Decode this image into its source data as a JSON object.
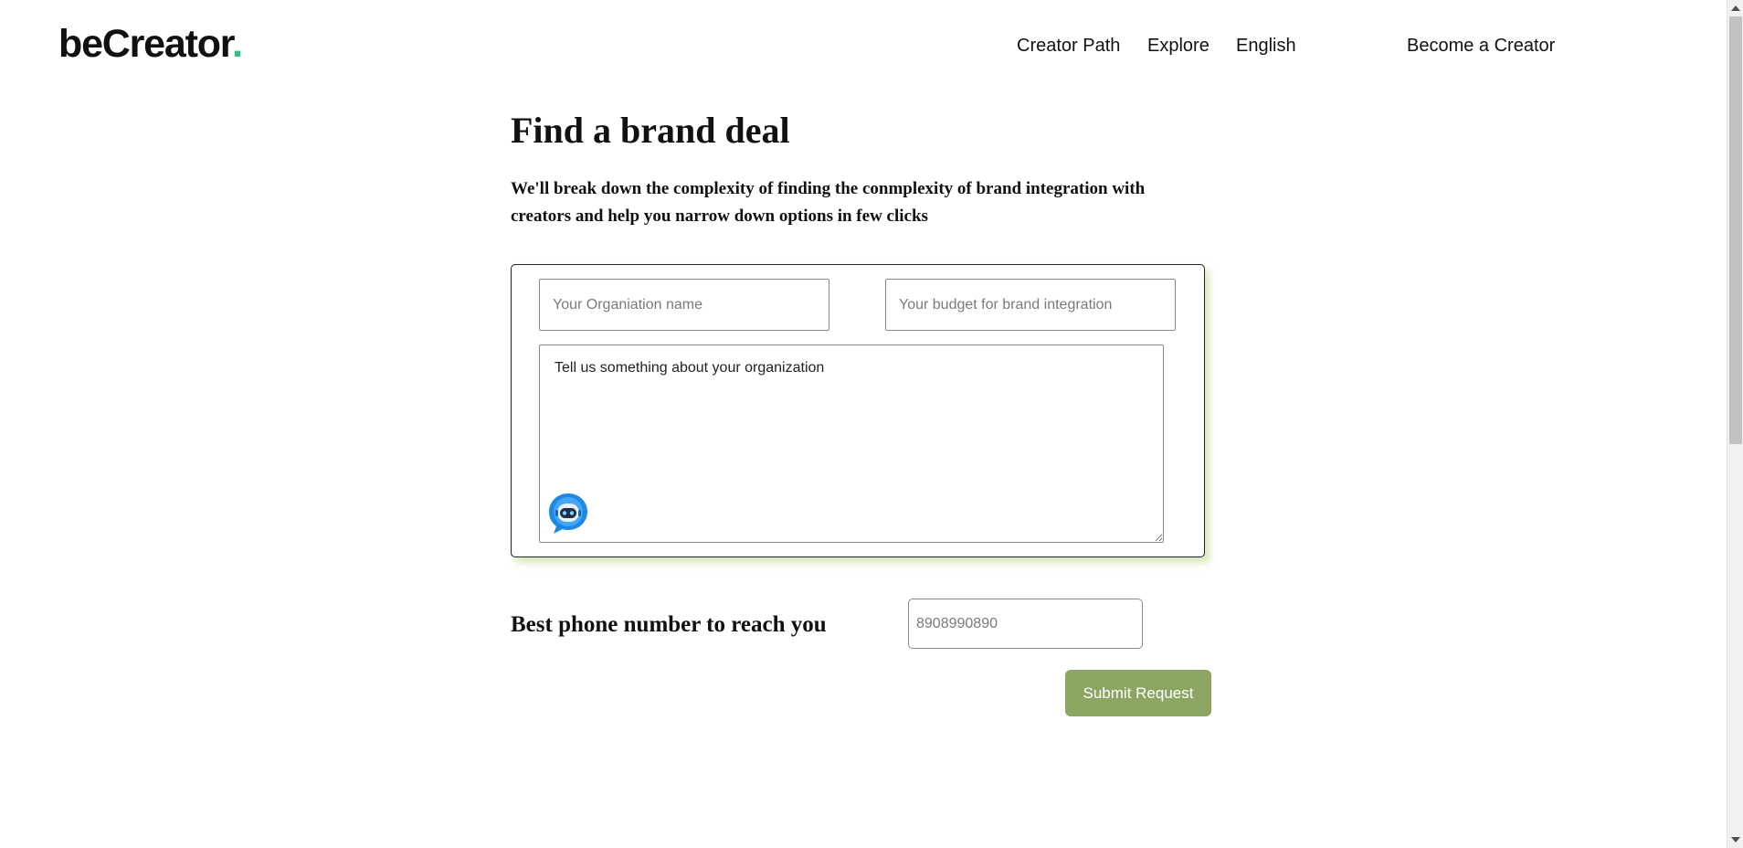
{
  "header": {
    "logo": {
      "text": "beCreator",
      "dot": ".",
      "dot_color": "#2ec27e"
    },
    "nav": {
      "creator_path": "Creator Path",
      "explore": "Explore",
      "language": "English",
      "become_creator": "Become a Creator"
    }
  },
  "main": {
    "title": "Find a brand deal",
    "subtitle": "We'll break down the complexity of finding the conmplexity of brand integration with creators and help you narrow down options in few clicks",
    "form": {
      "organization_placeholder": "Your Organiation name",
      "budget_placeholder": "Your budget for brand integration",
      "about_placeholder": "Tell us something about your organization",
      "chatbot_icon": "chatbot-icon"
    },
    "phone": {
      "label": "Best phone number to reach you",
      "placeholder": "8908990890"
    },
    "submit_label": "Submit Request"
  },
  "colors": {
    "accent_green": "#8ba663",
    "card_shadow": "#b5d06a",
    "logo_dot": "#2ec27e"
  }
}
